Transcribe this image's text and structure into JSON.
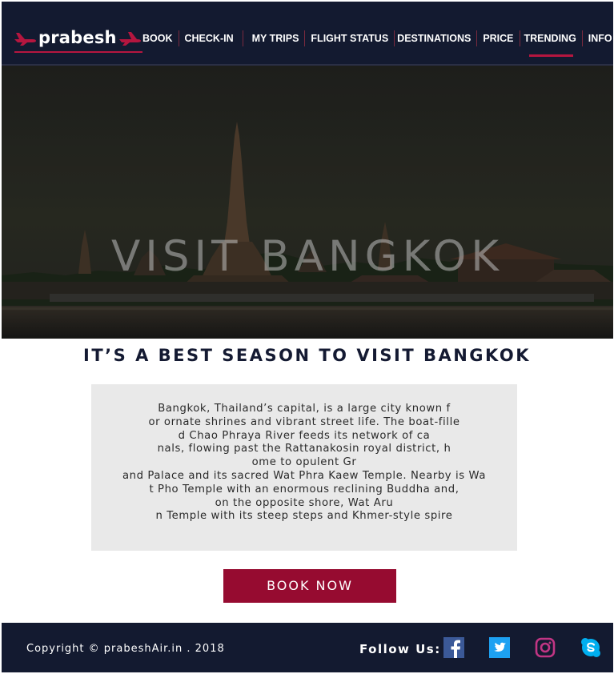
{
  "header": {
    "brand": "prabesh",
    "nav": [
      {
        "label": "BOOK",
        "name": "nav-book"
      },
      {
        "label": "CHECK-IN",
        "name": "nav-check-in"
      },
      {
        "label": "MY TRIPS",
        "name": "nav-my-trips"
      },
      {
        "label": "FLIGHT STATUS",
        "name": "nav-flight-status"
      },
      {
        "label": "DESTINATIONS",
        "name": "nav-destinations"
      },
      {
        "label": "PRICE",
        "name": "nav-price"
      },
      {
        "label": "TRENDING",
        "name": "nav-trending",
        "active": true
      },
      {
        "label": "INFO",
        "name": "nav-info"
      }
    ]
  },
  "hero": {
    "title": "VISIT BANGKOK"
  },
  "main": {
    "heading": "IT’S A BEST SEASON TO VISIT BANGKOK",
    "description_lines": [
      "Bangkok, Thailand’s capital, is a large city known f",
      "or ornate shrines and vibrant street life. The boat-fille",
      "d Chao Phraya River feeds its network of ca",
      "nals, flowing past the Rattanakosin royal district, h",
      "ome to opulent Gr",
      "and Palace and its sacred Wat Phra Kaew Temple. Nearby is Wa",
      "t Pho Temple with an enormous reclining Buddha and,",
      "on the opposite shore, Wat Aru",
      "n Temple with its steep steps and Khmer-style spire"
    ],
    "book_label": "BOOK NOW"
  },
  "footer": {
    "copyright": "Copyright © prabeshAir.in . 2018",
    "follow_label": "Follow Us:",
    "social": [
      {
        "icon": "facebook-icon",
        "color": "#3b5998"
      },
      {
        "icon": "twitter-icon",
        "color": "#1da1f2"
      },
      {
        "icon": "instagram-icon",
        "color": "#c13584"
      },
      {
        "icon": "skype-icon",
        "color": "#00aff0"
      }
    ]
  },
  "colors": {
    "navy": "#131a30",
    "accent": "#b5163f",
    "button": "#960b30",
    "panel": "#e9e9e9"
  }
}
